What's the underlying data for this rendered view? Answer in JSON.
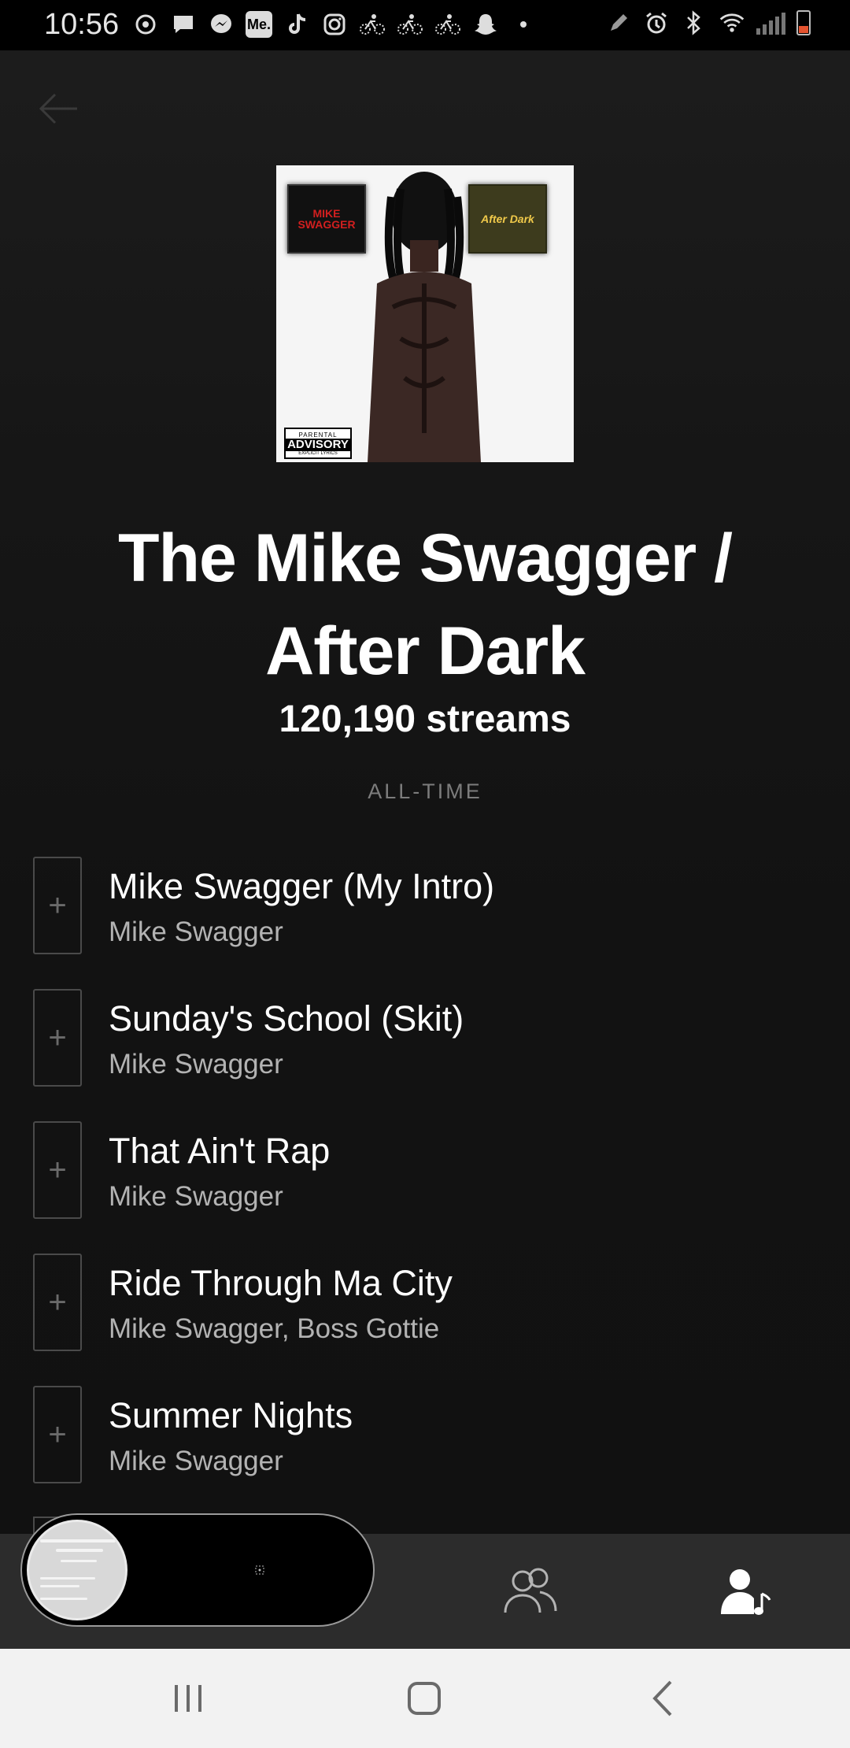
{
  "status_bar": {
    "time": "10:56",
    "left_icons": [
      "sync-icon",
      "chat-icon",
      "messenger-icon",
      "me-icon",
      "tiktok-icon",
      "instagram-icon",
      "bike-icon",
      "bike-icon",
      "bike-icon",
      "snapchat-icon",
      "dot-icon"
    ],
    "me_label": "Me.",
    "right_icons": [
      "pen-icon",
      "alarm-icon",
      "bluetooth-icon",
      "wifi-icon",
      "signal-icon",
      "battery-icon"
    ]
  },
  "header": {
    "back_icon": "arrow-left-icon"
  },
  "album": {
    "art_left_text": "MIKE SWAGGER",
    "art_right_text": "After Dark",
    "advisory_top": "PARENTAL",
    "advisory_mid": "ADVISORY",
    "advisory_bottom": "EXPLICIT LYRICS",
    "title_line1": "The Mike Swagger /",
    "title_line2": "After Dark",
    "streams": "120,190 streams",
    "range": "ALL-TIME"
  },
  "tracks": [
    {
      "title": "Mike Swagger (My Intro)",
      "artist": "Mike Swagger",
      "add_symbol": "+"
    },
    {
      "title": "Sunday's School (Skit)",
      "artist": "Mike Swagger",
      "add_symbol": "+"
    },
    {
      "title": "That Ain't Rap",
      "artist": "Mike Swagger",
      "add_symbol": "+"
    },
    {
      "title": "Ride Through Ma City",
      "artist": "Mike Swagger, Boss Gottie",
      "add_symbol": "+"
    },
    {
      "title": "Summer Nights",
      "artist": "Mike Swagger",
      "add_symbol": "+"
    }
  ],
  "bottom_nav": {
    "now_playing_icon": "album-thumbnail",
    "friends_icon": "friends-icon",
    "artist_icon": "artist-profile-icon"
  },
  "colors": {
    "background": "#121212",
    "text_primary": "#ffffff",
    "text_secondary": "#b3b3b3",
    "label_muted": "#7c7c7c",
    "nav_bar": "#2c2c2c"
  }
}
